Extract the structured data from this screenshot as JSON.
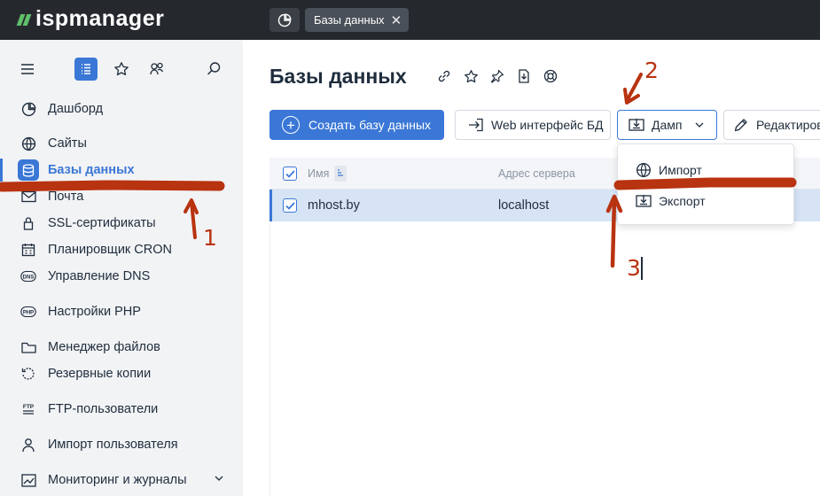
{
  "app": {
    "logo_text": "ispmanager"
  },
  "top_tabs": [
    {
      "label": "Базы данных"
    }
  ],
  "sidebar": {
    "items": [
      {
        "label": "Дашборд",
        "icon": "dashboard-icon"
      },
      {
        "label": "Сайты",
        "icon": "globe-icon"
      },
      {
        "label": "Базы данных",
        "icon": "database-icon",
        "active": true
      },
      {
        "label": "Почта",
        "icon": "mail-icon"
      },
      {
        "label": "SSL-сертификаты",
        "icon": "certificate-icon"
      },
      {
        "label": "Планировщик CRON",
        "icon": "calendar-icon"
      },
      {
        "label": "Управление DNS",
        "icon": "dns-icon"
      },
      {
        "label": "Настройки PHP",
        "icon": "php-icon"
      },
      {
        "label": "Менеджер файлов",
        "icon": "folder-icon"
      },
      {
        "label": "Резервные копии",
        "icon": "backup-icon"
      },
      {
        "label": "FTP-пользователи",
        "icon": "ftp-icon"
      },
      {
        "label": "Импорт пользователя",
        "icon": "import-user-icon"
      },
      {
        "label": "Мониторинг и журналы",
        "icon": "monitoring-icon"
      }
    ]
  },
  "main": {
    "title": "Базы данных",
    "toolbar": {
      "create_label": "Создать базу данных",
      "web_label": "Web интерфейс БД",
      "dump_label": "Дамп",
      "edit_label": "Редактиров"
    },
    "table": {
      "columns": [
        "Имя",
        "Адрес сервера"
      ],
      "rows": [
        {
          "name": "mhost.by",
          "server": "localhost",
          "selected": true
        }
      ]
    },
    "dump_menu": {
      "items": [
        {
          "label": "Импорт",
          "icon": "globe-import-icon"
        },
        {
          "label": "Экспорт",
          "icon": "export-icon"
        }
      ]
    }
  },
  "annotations": {
    "marks": [
      "1",
      "2",
      "3"
    ],
    "color": "#b83310"
  },
  "colors": {
    "accent": "#3a77d6",
    "topbar": "#25292e",
    "sidebar_bg": "#f2f3f5",
    "logo_green": "#5fbf6a"
  }
}
